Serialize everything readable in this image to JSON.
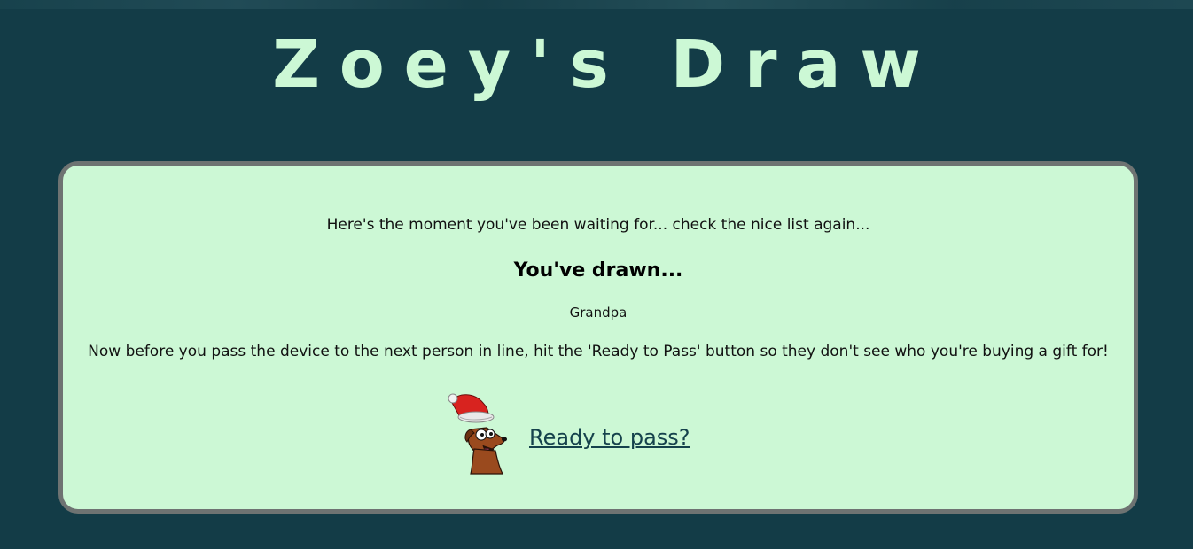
{
  "header": {
    "title": "Zoey's Draw"
  },
  "card": {
    "intro": "Here's the moment you've been waiting for... check the nice list again...",
    "heading": "You've drawn...",
    "drawn_name": "Grandpa",
    "instructions": "Now before you pass the device to the next person in line, hit the 'Ready to Pass' button so they don't see who you're buying a gift for!",
    "pass_link": "Ready to pass?"
  },
  "icons": {
    "mascot": "dog-with-santa-hat-icon"
  },
  "colors": {
    "background": "#133c47",
    "title": "#ccf8d5",
    "card_bg": "#ccf8d5",
    "card_border": "#6e7372",
    "link": "#15424c"
  }
}
